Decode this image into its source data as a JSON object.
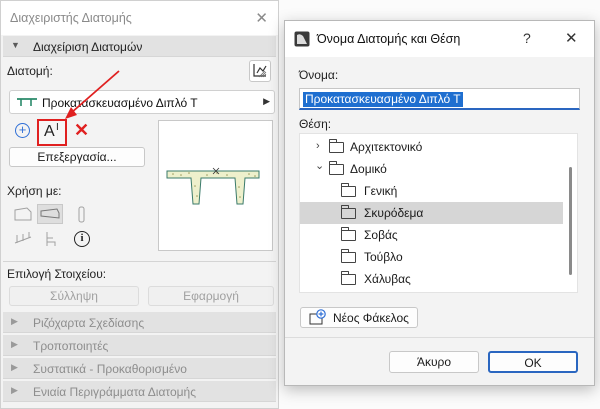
{
  "palette": {
    "title": "Διαχειριστής Διατομής",
    "section_profile": "Διαχείριση Διατομών",
    "profile_label": "Διατομή:",
    "selected_profile": "Προκατασκευασμένο Διπλό Τ",
    "edit_button": "Επεξεργασία...",
    "use_with_label": "Χρήση με:",
    "element_pick_label": "Επιλογή Στοιχείου:",
    "pick_up_button": "Σύλληψη",
    "apply_button": "Εφαρμογή",
    "collapsed_sections": [
      "Ριζόχαρτα Σχεδίασης",
      "Τροποποιητές",
      "Συστατικά - Προκαθορισμένο",
      "Ενιαία Περιγράμματα Διατομής"
    ]
  },
  "dialog": {
    "title": "Όνομα Διατομής και Θέση",
    "help": "?",
    "name_label": "Όνομα:",
    "name_value": "Προκατασκευασμένο Διπλό Τ",
    "location_label": "Θέση:",
    "tree": [
      {
        "label": "Αρχιτεκτονικό",
        "level": 0,
        "expander": "›"
      },
      {
        "label": "Δομικό",
        "level": 0,
        "expander": "⌄"
      },
      {
        "label": "Γενική",
        "level": 1
      },
      {
        "label": "Σκυρόδεμα",
        "level": 1,
        "selected": true
      },
      {
        "label": "Σοβάς",
        "level": 1
      },
      {
        "label": "Τούβλο",
        "level": 1
      },
      {
        "label": "Χάλυβας",
        "level": 1
      }
    ],
    "new_folder_button": "Νέος Φάκελος",
    "cancel_button": "Άκυρο",
    "ok_button": "OK"
  },
  "colors": {
    "highlight": "#e02020",
    "accent": "#1f6fd0",
    "info_blue": "#2f6fd6"
  }
}
